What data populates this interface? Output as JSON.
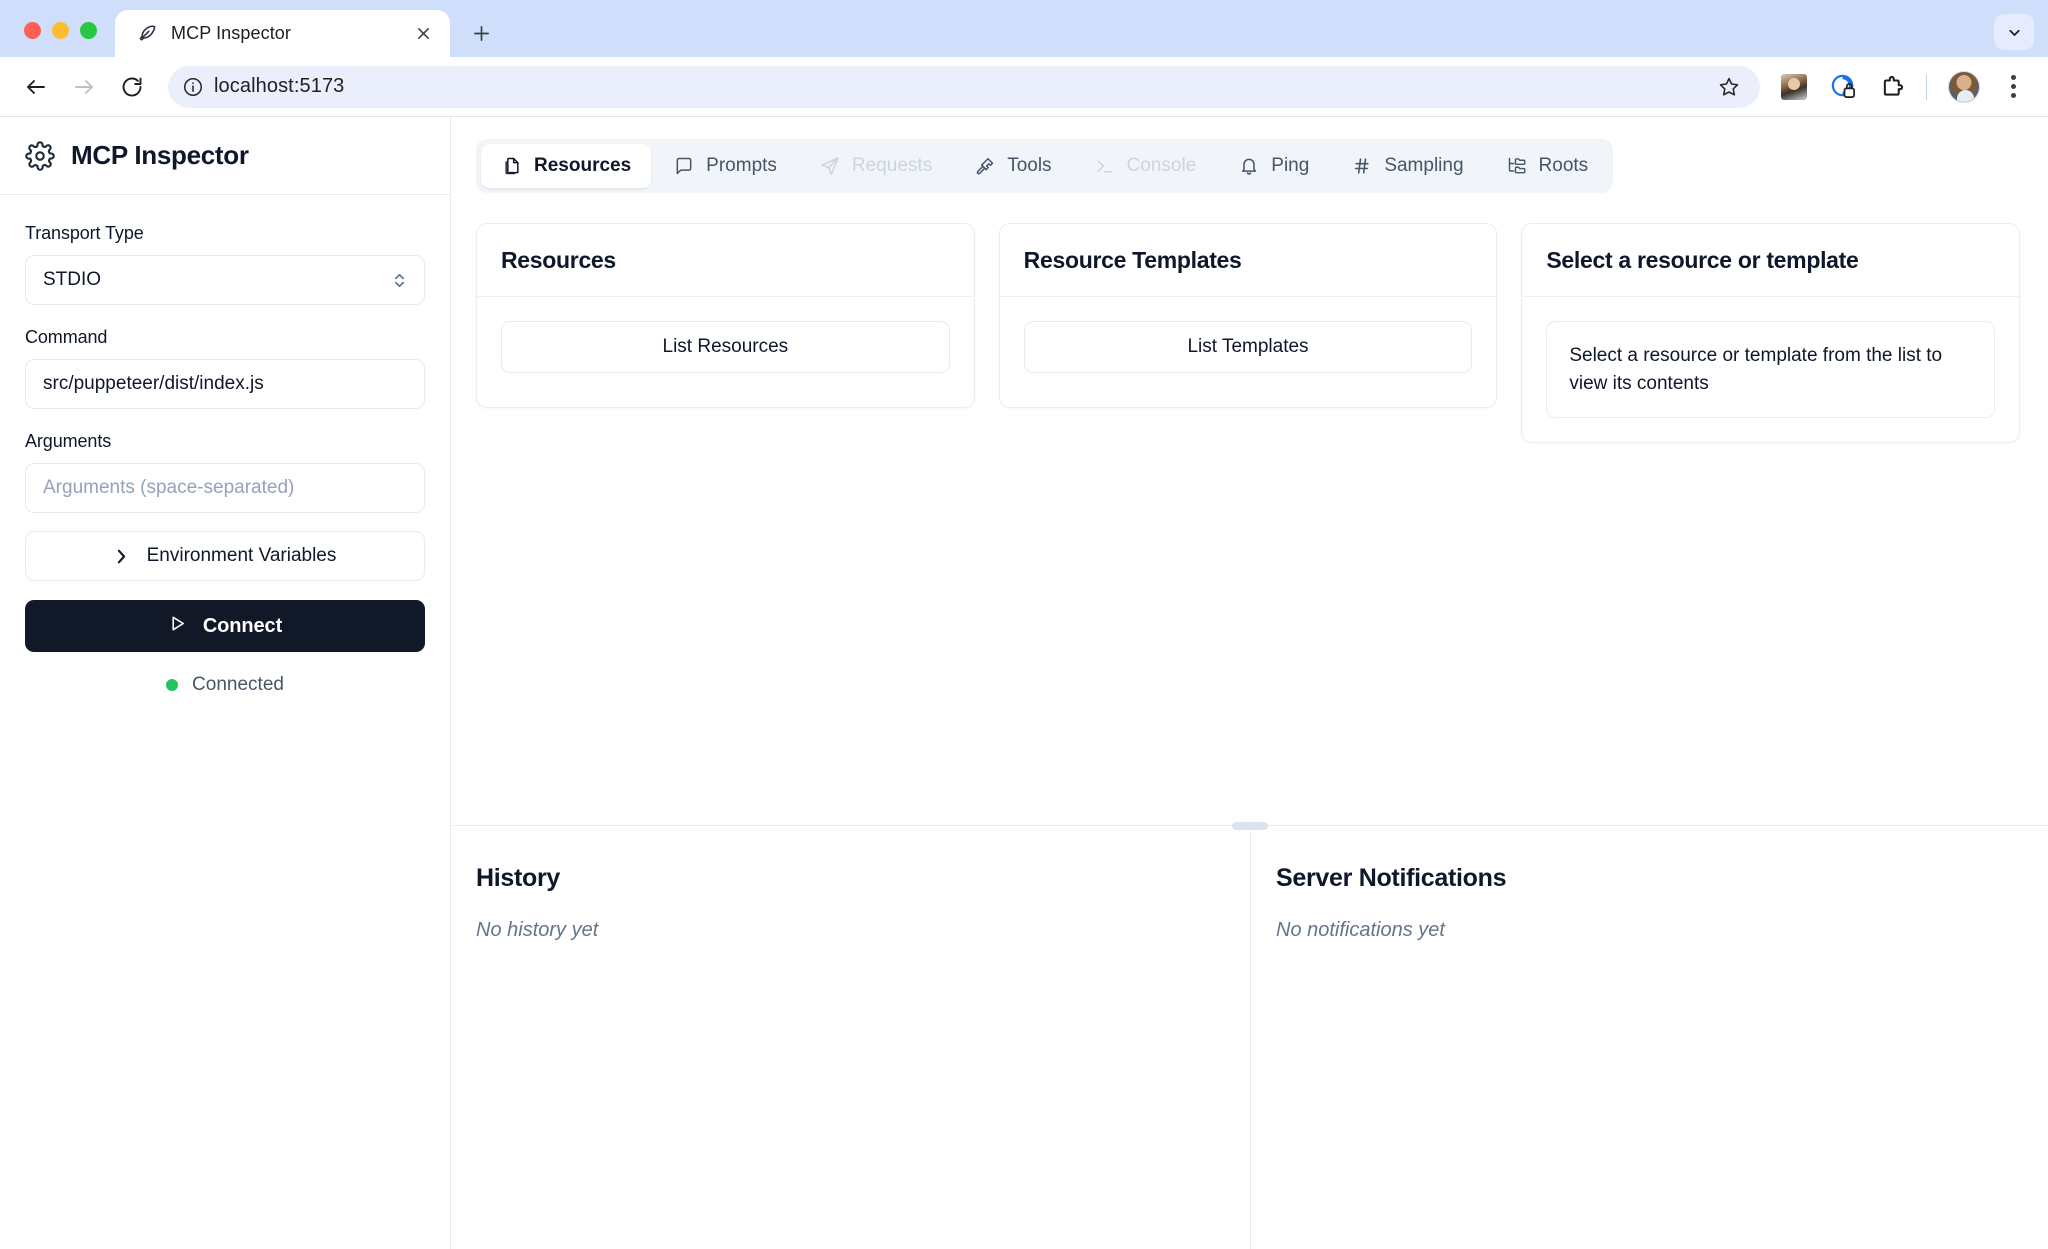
{
  "browser": {
    "tab": {
      "title": "MCP Inspector",
      "favicon_icon": "feather-logo-icon",
      "close_icon": "close-icon"
    },
    "new_tab_label": "+",
    "tab_search_icon": "chevron-down-icon",
    "nav": {
      "back_icon": "arrow-left-icon",
      "forward_icon": "arrow-right-icon",
      "reload_icon": "reload-icon"
    },
    "omnibox": {
      "info_icon": "info-circle-icon",
      "url": "localhost:5173",
      "star_icon": "star-icon"
    },
    "toolbar_icons": [
      {
        "name": "extension-photo-icon"
      },
      {
        "name": "privacy-lock-icon"
      },
      {
        "name": "puzzle-extensions-icon"
      },
      {
        "name": "profile-avatar-icon"
      },
      {
        "name": "chrome-menu-kebab-icon"
      }
    ]
  },
  "sidebar": {
    "app_icon": "gear-icon",
    "app_title": "MCP Inspector",
    "transport": {
      "label": "Transport Type",
      "value": "STDIO",
      "caret_icon": "chevron-up-down-icon"
    },
    "command": {
      "label": "Command",
      "value": "src/puppeteer/dist/index.js"
    },
    "arguments": {
      "label": "Arguments",
      "value": "",
      "placeholder": "Arguments (space-separated)"
    },
    "env_button": {
      "label": "Environment Variables",
      "icon": "chevron-right-icon"
    },
    "connect_button": {
      "label": "Connect",
      "icon": "play-icon"
    },
    "status": {
      "label": "Connected",
      "color": "#22c55e"
    }
  },
  "main": {
    "tabs": [
      {
        "label": "Resources",
        "icon": "files-copy-icon",
        "state": "active"
      },
      {
        "label": "Prompts",
        "icon": "message-square-icon",
        "state": "normal"
      },
      {
        "label": "Requests",
        "icon": "send-paper-plane-icon",
        "state": "disabled"
      },
      {
        "label": "Tools",
        "icon": "hammer-icon",
        "state": "normal"
      },
      {
        "label": "Console",
        "icon": "terminal-icon",
        "state": "disabled"
      },
      {
        "label": "Ping",
        "icon": "bell-icon",
        "state": "normal"
      },
      {
        "label": "Sampling",
        "icon": "hash-icon",
        "state": "normal"
      },
      {
        "label": "Roots",
        "icon": "folder-tree-icon",
        "state": "normal"
      }
    ],
    "cards": [
      {
        "title": "Resources",
        "button_label": "List Resources"
      },
      {
        "title": "Resource Templates",
        "button_label": "List Templates"
      },
      {
        "title": "Select a resource or template",
        "empty_text": "Select a resource or template from the list to view its contents"
      }
    ]
  },
  "bottom": {
    "history": {
      "title": "History",
      "empty": "No history yet"
    },
    "notifications": {
      "title": "Server Notifications",
      "empty": "No notifications yet"
    },
    "resize_handle_icon": "resize-grip-icon"
  },
  "colors": {
    "accent_dark": "#111827",
    "tab_bar_bg": "#f1f5f9",
    "chrome_tabstrip": "#cfdefa",
    "status_green": "#22c55e"
  }
}
